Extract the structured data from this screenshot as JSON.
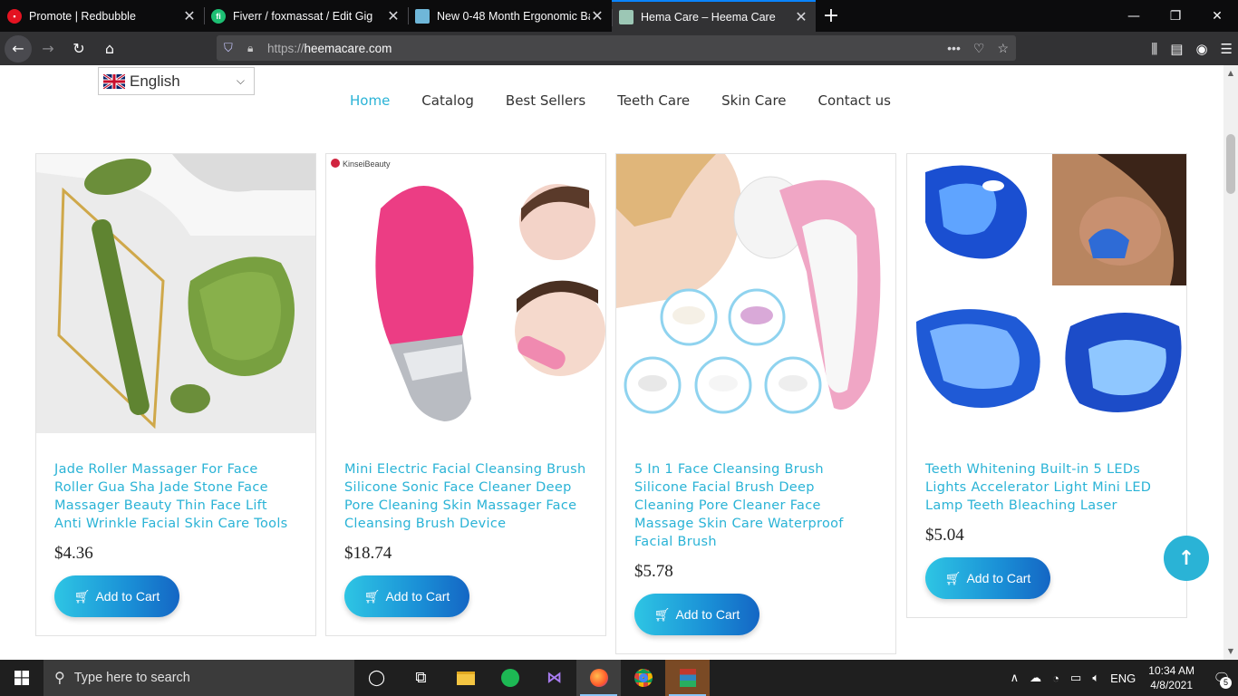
{
  "browser": {
    "tabs": [
      {
        "title": "Promote | Redbubble",
        "favicon_color": "#e41321",
        "favicon_char": "R",
        "active": false
      },
      {
        "title": "Fiverr / foxmassat / Edit Gig",
        "favicon_color": "#1dbf73",
        "favicon_char": "fi",
        "active": false
      },
      {
        "title": "New 0-48 Month Ergonomic Ba",
        "favicon_color": "#6fb7d9",
        "favicon_char": "",
        "active": false
      },
      {
        "title": "Hema Care – Heema Care",
        "favicon_color": "#9cc7b5",
        "favicon_char": "",
        "active": true
      }
    ],
    "close_glyph": "✕",
    "new_tab_glyph": "+",
    "url_prefix": "https://",
    "url_domain": "heemacare.com"
  },
  "site": {
    "language": "English",
    "menu": [
      "Home",
      "Catalog",
      "Best Sellers",
      "Teeth Care",
      "Skin Care",
      "Contact us"
    ],
    "active_menu": "Home",
    "accent_color": "#2ab3d6",
    "products": [
      {
        "title": "Jade Roller Massager For Face Roller Gua Sha Jade Stone Face Massager Beauty Thin Face Lift Anti Wrinkle Facial Skin Care Tools",
        "price": "$4.36",
        "button": "Add to Cart",
        "image": "jade-roller-image"
      },
      {
        "title": "Mini Electric Facial Cleansing Brush Silicone Sonic Face Cleaner Deep Pore Cleaning Skin Massager Face Cleansing Brush Device",
        "price": "$18.74",
        "button": "Add to Cart",
        "image": "facial-cleansing-brush-image",
        "brand_text": "KinseiBeauty"
      },
      {
        "title": "5 In 1 Face Cleansing Brush Silicone Facial Brush Deep Cleaning Pore Cleaner Face Massage Skin Care Waterproof Facial Brush",
        "price": "$5.78",
        "button": "Add to Cart",
        "image": "five-in-one-brush-image"
      },
      {
        "title": "Teeth Whitening Built-in 5 LEDs Lights Accelerator Light Mini LED Lamp Teeth Bleaching Laser",
        "price": "$5.04",
        "button": "Add to Cart",
        "image": "teeth-whitening-led-image"
      }
    ]
  },
  "taskbar": {
    "search_placeholder": "Type here to search",
    "language": "ENG",
    "time": "10:34 AM",
    "date": "4/8/2021",
    "notification_count": "5"
  }
}
